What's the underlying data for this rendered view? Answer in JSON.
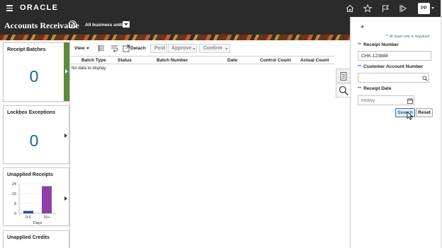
{
  "app": {
    "brand": "ORACLE",
    "user_initials": "PP",
    "top_icons": [
      "home-icon",
      "star-icon",
      "flag-icon",
      "play-icon"
    ]
  },
  "header": {
    "title": "Accounts Receivable",
    "business_unit": "All business units"
  },
  "tiles": {
    "receipt_batches": {
      "title": "Receipt Batches",
      "value": "0"
    },
    "lockbox_exceptions": {
      "title": "Lockbox Exceptions",
      "value": "0"
    },
    "unapplied_receipts": {
      "title": "Unapplied Receipts"
    },
    "unapplied_credits": {
      "title": "Unapplied Credits"
    }
  },
  "chart_data": {
    "type": "bar",
    "categories": [
      "0-6",
      "10+"
    ],
    "values": [
      2,
      22
    ],
    "xlabel": "Days",
    "ylabel": "",
    "ylim": [
      0,
      24
    ],
    "yticks": [
      "24",
      "16",
      "8",
      "0"
    ],
    "colors": [
      "#1f4ea8",
      "#8e3fa5"
    ]
  },
  "toolbar": {
    "view": "View",
    "detach": "Detach",
    "post": "Post",
    "approve": "Approve",
    "confirm": "Confirm"
  },
  "grid": {
    "columns": [
      "Batch Type",
      "Status",
      "Batch Number",
      "Date",
      "Control Count",
      "Actual Count"
    ],
    "empty_text": "No data to display."
  },
  "search": {
    "required_note": "** At least one is required",
    "receipt_number_label": "Receipt Number",
    "receipt_number_value": "CHK-123888",
    "customer_account_label": "Customer Account Number",
    "customer_account_value": "",
    "receipt_date_label": "Receipt Date",
    "receipt_date_placeholder": "m/d/yy",
    "search_button": "Search",
    "reset_button": "Reset",
    "stars": "**"
  }
}
